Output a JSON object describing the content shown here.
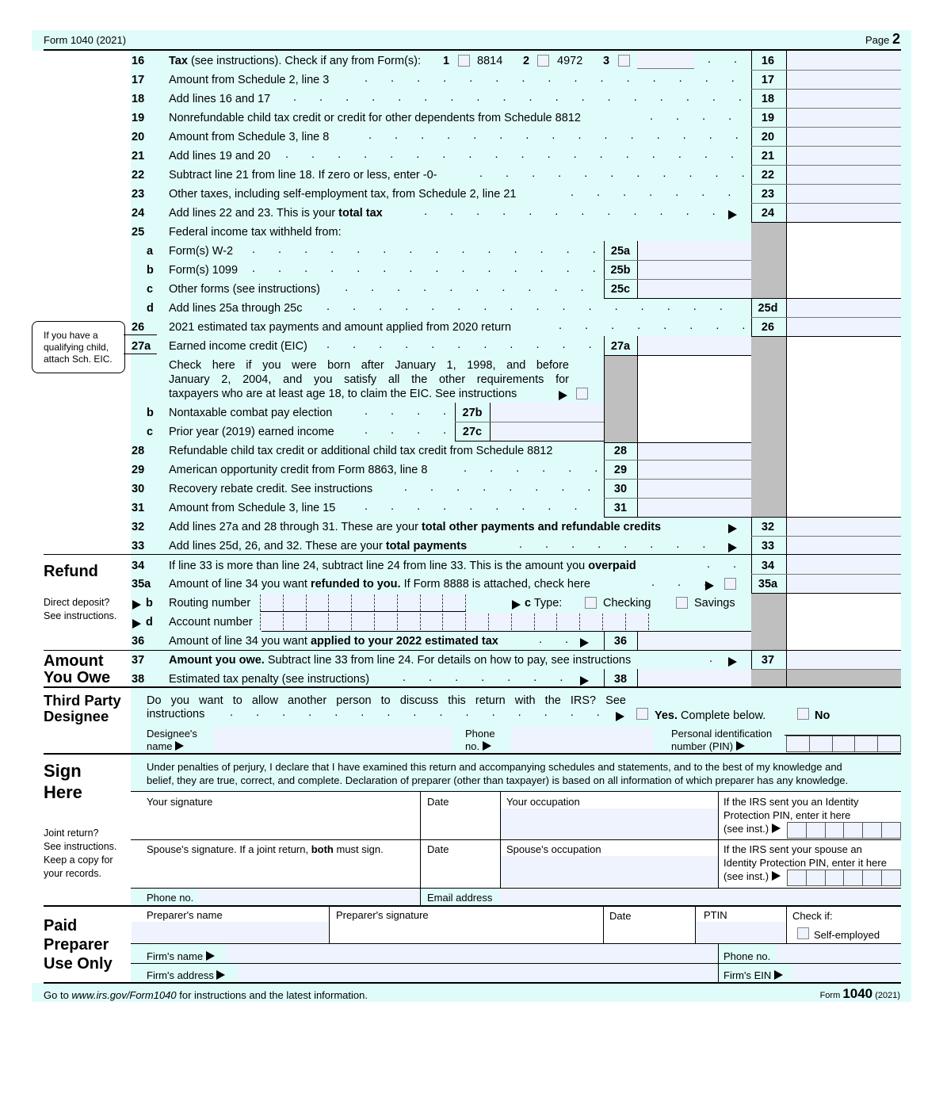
{
  "header": {
    "form_label": "Form 1040 (2021)",
    "page_prefix": "Page",
    "page_number": "2"
  },
  "lines": {
    "l16": {
      "num": "16",
      "tax_bold": "Tax",
      "text": " (see instructions). Check if any from Form(s):",
      "opt1_num": "1",
      "opt1_label": "8814",
      "opt2_num": "2",
      "opt2_label": "4972",
      "opt3_num": "3",
      "box": "16"
    },
    "l17": {
      "num": "17",
      "text": "Amount from Schedule 2, line 3",
      "box": "17"
    },
    "l18": {
      "num": "18",
      "text": "Add lines 16 and 17",
      "box": "18"
    },
    "l19": {
      "num": "19",
      "text": "Nonrefundable child tax credit or credit for other dependents from Schedule 8812",
      "box": "19"
    },
    "l20": {
      "num": "20",
      "text": "Amount from Schedule 3, line 8",
      "box": "20"
    },
    "l21": {
      "num": "21",
      "text": "Add lines 19 and 20",
      "box": "21"
    },
    "l22": {
      "num": "22",
      "text": "Subtract line 21 from line 18. If zero or less, enter -0-",
      "box": "22"
    },
    "l23": {
      "num": "23",
      "text": "Other taxes, including self-employment tax, from Schedule 2, line 21",
      "box": "23"
    },
    "l24": {
      "num": "24",
      "text": "Add lines 22 and 23. This is your ",
      "bold": "total tax",
      "box": "24"
    },
    "l25": {
      "num": "25",
      "text": "Federal income tax withheld from:"
    },
    "l25a": {
      "num": "a",
      "text": "Form(s) W-2",
      "box": "25a"
    },
    "l25b": {
      "num": "b",
      "text": "Form(s) 1099",
      "box": "25b"
    },
    "l25c": {
      "num": "c",
      "text": "Other forms (see instructions)",
      "box": "25c"
    },
    "l25d": {
      "num": "d",
      "text": "Add lines 25a through 25c",
      "box": "25d"
    },
    "l26": {
      "num": "26",
      "text": "2021 estimated tax payments and amount applied from 2020 return",
      "box": "26"
    },
    "l27a": {
      "num": "27a",
      "text": "Earned income credit (EIC)",
      "box": "27a"
    },
    "l27check": {
      "line1": "Check here if you were born after January 1, 1998, and before",
      "line2": "January 2, 2004, and you satisfy all the other requirements for",
      "line3": "taxpayers who are at least age 18, to claim the EIC. See instructions"
    },
    "l27b": {
      "num": "b",
      "text": "Nontaxable combat pay election",
      "box": "27b"
    },
    "l27c": {
      "num": "c",
      "text": "Prior year (2019) earned income",
      "box": "27c"
    },
    "l28": {
      "num": "28",
      "text": "Refundable child tax credit or additional child tax credit from Schedule 8812",
      "box": "28"
    },
    "l29": {
      "num": "29",
      "text": "American opportunity credit from Form 8863, line 8",
      "box": "29"
    },
    "l30": {
      "num": "30",
      "text": "Recovery rebate credit. See instructions",
      "box": "30"
    },
    "l31": {
      "num": "31",
      "text": "Amount from Schedule 3, line 15",
      "box": "31"
    },
    "l32": {
      "num": "32",
      "text": "Add lines 27a and 28 through 31. These are your ",
      "bold": "total other payments and refundable credits",
      "box": "32"
    },
    "l33": {
      "num": "33",
      "text": "Add lines 25d, 26, and 32. These are your ",
      "bold": "total payments",
      "box": "33"
    },
    "l34": {
      "num": "34",
      "text": "If line 33 is more than line 24, subtract line 24 from line 33. This is the amount you ",
      "bold": "overpaid",
      "box": "34"
    },
    "l35a": {
      "num": "35a",
      "text": "Amount of line 34 you want ",
      "bold": "refunded to you.",
      "text2": " If Form 8888 is attached, check here",
      "box": "35a"
    },
    "l35b": {
      "num": "b",
      "text": "Routing number"
    },
    "l35c": {
      "num": "c",
      "text": "Type:",
      "checking": "Checking",
      "savings": "Savings"
    },
    "l35d": {
      "num": "d",
      "text": "Account number"
    },
    "l36": {
      "num": "36",
      "text": "Amount of line 34 you want ",
      "bold": "applied to your 2022 estimated tax",
      "box": "36"
    },
    "l37": {
      "num": "37",
      "bold": "Amount you owe.",
      "text": " Subtract line 33 from line 24. For details on how to pay, see instructions",
      "box": "37"
    },
    "l38": {
      "num": "38",
      "text": "Estimated tax penalty (see instructions)",
      "box": "38"
    }
  },
  "callout": {
    "line1": "If you have a",
    "line2": "qualifying child,",
    "line3": "attach Sch. EIC."
  },
  "sections": {
    "refund": "Refund",
    "direct_deposit1": "Direct deposit?",
    "direct_deposit2": "See instructions.",
    "amount1": "Amount",
    "amount2": "You Owe",
    "tpd1": "Third Party",
    "tpd2": "Designee",
    "sign1": "Sign",
    "sign2": "Here",
    "joint1": "Joint return?",
    "joint2": "See instructions.",
    "joint3": "Keep a copy for",
    "joint4": "your records.",
    "paid1": "Paid",
    "paid2": "Preparer",
    "paid3": "Use Only"
  },
  "designee": {
    "question1": "Do you want to allow another person to discuss this return with the IRS? See",
    "question2": "instructions",
    "yes_bold": "Yes.",
    "yes_text": " Complete below.",
    "no": "No",
    "name_label1": "Designee's",
    "name_label2": "name",
    "phone_label1": "Phone",
    "phone_label2": "no.",
    "pin_label1": "Personal identification",
    "pin_label2": "number (PIN)"
  },
  "sign": {
    "declaration1": "Under penalties of perjury, I declare that I have examined this return and accompanying schedules and statements, and to the best of my knowledge and",
    "declaration2": "belief, they are true, correct, and complete. Declaration of preparer (other than taxpayer) is based on all information of which preparer has any knowledge.",
    "your_signature": "Your signature",
    "date": "Date",
    "your_occupation": "Your occupation",
    "ip_pin1": "If the IRS sent you an Identity",
    "ip_pin2": "Protection PIN, enter it here",
    "ip_pin3": "(see inst.)",
    "spouse_sig_a": "Spouse's signature. If a joint return, ",
    "spouse_sig_bold": "both",
    "spouse_sig_b": " must sign.",
    "spouse_date": "Date",
    "spouse_occupation": "Spouse's occupation",
    "sp_pin1": "If the IRS sent your spouse an",
    "sp_pin2": "Identity Protection PIN, enter it here",
    "sp_pin3": "(see inst.)",
    "phone": "Phone no.",
    "email": "Email address"
  },
  "preparer": {
    "name": "Preparer's name",
    "signature": "Preparer's signature",
    "date": "Date",
    "ptin": "PTIN",
    "check_if": "Check if:",
    "self_employed": "Self-employed",
    "firm_name": "Firm's name",
    "firm_phone": "Phone no.",
    "firm_address": "Firm's address",
    "firm_ein": "Firm's EIN"
  },
  "footer": {
    "go_to": "Go to ",
    "url": "www.irs.gov/Form1040",
    "rest": " for instructions and the latest information.",
    "form_word": "Form",
    "form_num": "1040",
    "year": "(2021)"
  }
}
